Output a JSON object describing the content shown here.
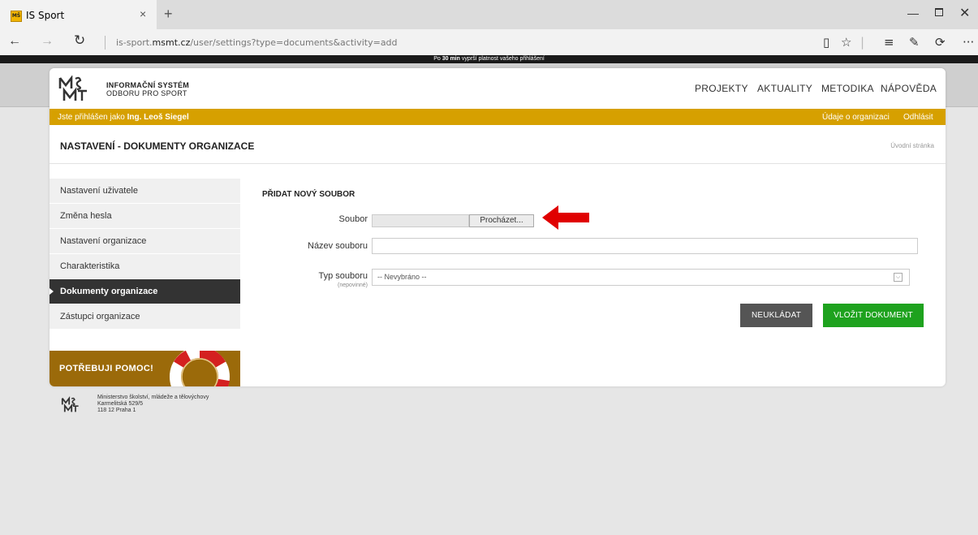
{
  "browser": {
    "tab_title": "IS Sport",
    "tab_close": "×",
    "new_tab": "+",
    "favicon_text": "MŠ",
    "address_prefix": "is-sport.",
    "address_domain": "msmt.cz",
    "address_path": "/user/settings?type=documents&activity=add",
    "icons": [
      "back-arrow-icon",
      "forward-arrow-icon",
      "refresh-icon",
      "reading-view-icon",
      "favorite-star-icon",
      "hub-icon",
      "web-note-icon",
      "share-icon",
      "more-icon"
    ]
  },
  "session": {
    "prefix": "Po ",
    "minutes": "30 min",
    "suffix": " vyprší platnost vašeho přihlášení"
  },
  "header": {
    "logo_line1": "INFORMAČNÍ SYSTÉM",
    "logo_line2": "ODBORU PRO SPORT",
    "menu": [
      "PROJEKTY",
      "AKTUALITY",
      "METODIKA",
      "NÁPOVĚDA"
    ]
  },
  "userbar": {
    "logged_in_prefix": "Jste přihlášen jako ",
    "user_name": "Ing. Leoš Siegel",
    "org_link": "Údaje o organizaci",
    "logout_link": "Odhlásit",
    "color": "#d6a000"
  },
  "page": {
    "title": "NASTAVENÍ - DOKUMENTY ORGANIZACE",
    "home_link": "Úvodní stránka"
  },
  "sidebar": {
    "items": [
      {
        "label": "Nastavení uživatele",
        "active": false
      },
      {
        "label": "Změna hesla",
        "active": false
      },
      {
        "label": "Nastavení organizace",
        "active": false
      },
      {
        "label": "Charakteristika",
        "active": false
      },
      {
        "label": "Dokumenty organizace",
        "active": true
      },
      {
        "label": "Zástupci organizace",
        "active": false
      }
    ],
    "help_label": "POTŘEBUJI POMOC!"
  },
  "form": {
    "heading": "PŘIDAT NOVÝ SOUBOR",
    "file_label": "Soubor",
    "browse_label": "Procházet...",
    "name_label": "Název souboru",
    "name_value": "",
    "type_label": "Typ souboru",
    "type_sublabel": "(nepovinné)",
    "type_selected": "-- Nevybráno --",
    "cancel_label": "NEUKLÁDAT",
    "submit_label": "VLOŽIT DOKUMENT",
    "submit_color": "#1ea21e",
    "cancel_color": "#555555"
  },
  "annotation": {
    "arrow_color": "#e00000"
  },
  "footer": {
    "line1": "Ministerstvo školství, mládeže a tělovýchovy",
    "line2": "Karmelitská 529/5",
    "line3": "118 12 Praha 1"
  }
}
